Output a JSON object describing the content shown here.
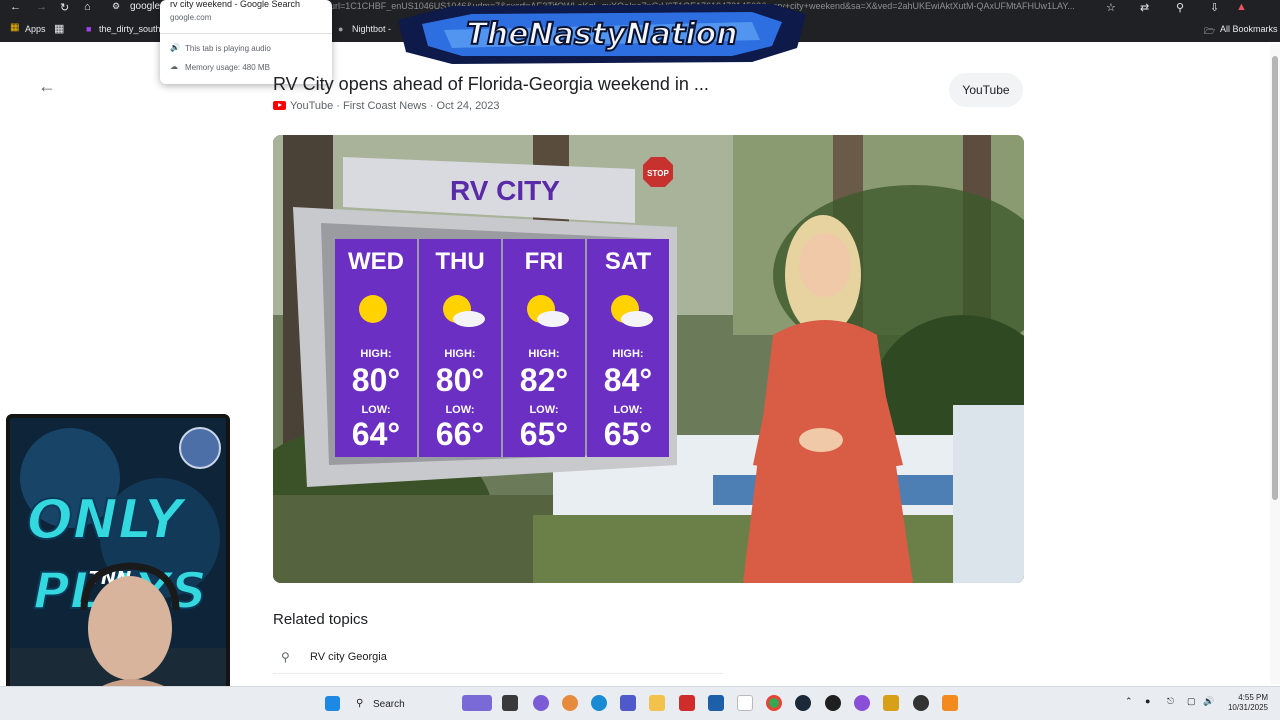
{
  "browser": {
    "tab_title": "google",
    "url": "url=1C1CHBF_enUS1046US1046&udm=7&sxsrf=AE3TifOWLeKgL-gxXOeIno7pGrV6T1QE1761947214502&q=rv+city+weekend&sa=X&ved=2ahUKEwiAktXutM-QAxUFMtAFHUw1LAY...",
    "tooltip": {
      "title": "rv city weekend - Google Search",
      "domain": "google.com",
      "audio": "This tab is playing audio",
      "memory": "Memory usage: 480 MB"
    },
    "bookmarks": {
      "apps": "Apps",
      "item1": "the_dirty_southga...",
      "item2": "Nightbot -",
      "all": "All Bookmarks"
    }
  },
  "overlay": {
    "banner": "TheNastyNation"
  },
  "result": {
    "title": "RV City opens ahead of Florida-Georgia weekend in ...",
    "source": "YouTube",
    "channel": "First Coast News",
    "date": "Oct 24, 2023",
    "button": "YouTube"
  },
  "video": {
    "sign_title": "RV CITY",
    "stop_sign": "STOP",
    "forecast": [
      {
        "day": "WED",
        "high_label": "HIGH:",
        "high": "80°",
        "low_label": "LOW:",
        "low": "64°"
      },
      {
        "day": "THU",
        "high_label": "HIGH:",
        "high": "80°",
        "low_label": "LOW:",
        "low": "66°"
      },
      {
        "day": "FRI",
        "high_label": "HIGH:",
        "high": "82°",
        "low_label": "LOW:",
        "low": "65°"
      },
      {
        "day": "SAT",
        "high_label": "HIGH:",
        "high": "84°",
        "low_label": "LOW:",
        "low": "65°"
      }
    ]
  },
  "related": {
    "heading": "Related topics",
    "items": [
      "RV city Georgia"
    ]
  },
  "webcam": {
    "line1": "ONLY",
    "line2": "PLAYS",
    "tag": "TNN"
  },
  "taskbar": {
    "search": "Search",
    "time": "4:55 PM",
    "date": "10/31/2025"
  }
}
